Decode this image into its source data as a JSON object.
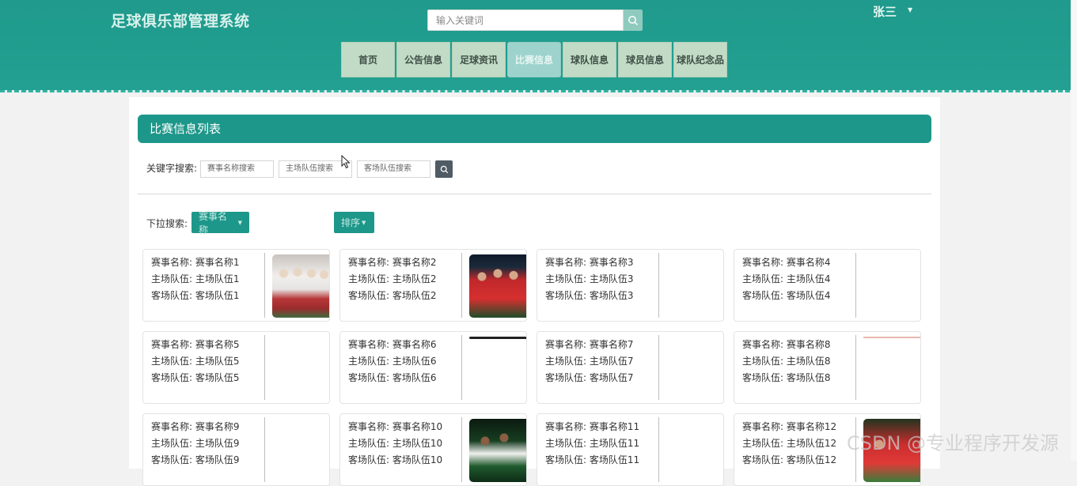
{
  "header": {
    "site_title": "足球俱乐部管理系统",
    "search_placeholder": "输入关键词",
    "user_name": "张三",
    "nav": [
      "首页",
      "公告信息",
      "足球资讯",
      "比赛信息",
      "球队信息",
      "球员信息",
      "球队纪念品"
    ],
    "active_nav": "比赛信息",
    "colors": {
      "primary": "#1d978a",
      "nav_bg": "#c1dbc6",
      "nav_active": "#9ed3cd"
    }
  },
  "list": {
    "title": "比赛信息列表",
    "keyword_label": "关键字搜索:",
    "keyword_placeholders": [
      "赛事名称搜索",
      "主场队伍搜索",
      "客场队伍搜索"
    ],
    "dropdown_label": "下拉搜索:",
    "dropdown_button": "赛事名称",
    "sort_button": "排序"
  },
  "cards": [
    {
      "name_label": "赛事名称: 赛事名称1",
      "home_label": "主场队伍: 主场队伍1",
      "away_label": "客场队伍: 客场队伍1",
      "image": "team-photo"
    },
    {
      "name_label": "赛事名称: 赛事名称2",
      "home_label": "主场队伍: 主场队伍2",
      "away_label": "客场队伍: 客场队伍2",
      "image": "team-photo"
    },
    {
      "name_label": "赛事名称: 赛事名称3",
      "home_label": "主场队伍: 主场队伍3",
      "away_label": "客场队伍: 客场队伍3",
      "image": "none"
    },
    {
      "name_label": "赛事名称: 赛事名称4",
      "home_label": "主场队伍: 主场队伍4",
      "away_label": "客场队伍: 客场队伍4",
      "image": "none"
    },
    {
      "name_label": "赛事名称: 赛事名称5",
      "home_label": "主场队伍: 主场队伍5",
      "away_label": "客场队伍: 客场队伍5",
      "image": "none"
    },
    {
      "name_label": "赛事名称: 赛事名称6",
      "home_label": "主场队伍: 主场队伍6",
      "away_label": "客场队伍: 客场队伍6",
      "image": "partial"
    },
    {
      "name_label": "赛事名称: 赛事名称7",
      "home_label": "主场队伍: 主场队伍7",
      "away_label": "客场队伍: 客场队伍7",
      "image": "none"
    },
    {
      "name_label": "赛事名称: 赛事名称8",
      "home_label": "主场队伍: 主场队伍8",
      "away_label": "客场队伍: 客场队伍8",
      "image": "partial"
    },
    {
      "name_label": "赛事名称: 赛事名称9",
      "home_label": "主场队伍: 主场队伍9",
      "away_label": "客场队伍: 客场队伍9",
      "image": "none"
    },
    {
      "name_label": "赛事名称: 赛事名称10",
      "home_label": "主场队伍: 主场队伍10",
      "away_label": "客场队伍: 客场队伍10",
      "image": "team-photo"
    },
    {
      "name_label": "赛事名称: 赛事名称11",
      "home_label": "主场队伍: 主场队伍11",
      "away_label": "客场队伍: 客场队伍11",
      "image": "none"
    },
    {
      "name_label": "赛事名称: 赛事名称12",
      "home_label": "主场队伍: 主场队伍12",
      "away_label": "客场队伍: 客场队伍12",
      "image": "team-photo"
    }
  ],
  "watermark": "CSDN @专业程序开发源"
}
